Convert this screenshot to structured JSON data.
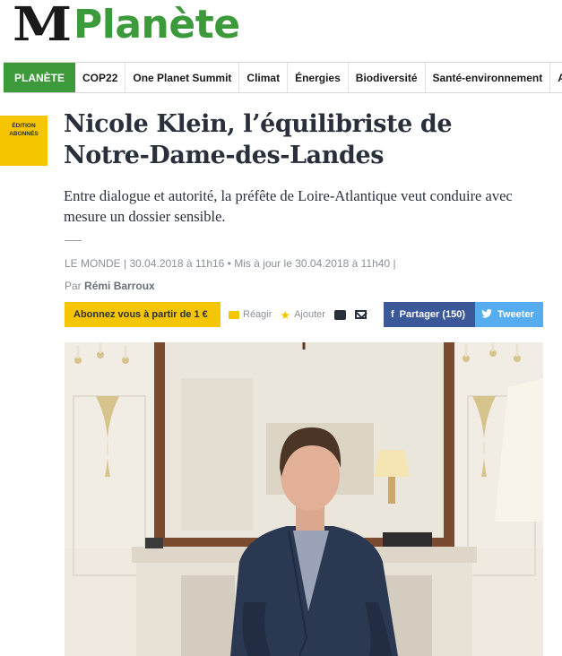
{
  "masthead": {
    "logo": "M",
    "section": "Planète"
  },
  "nav": {
    "home": "PLANÈTE",
    "items": [
      "COP22",
      "One Planet Summit",
      "Climat",
      "Énergies",
      "Biodiversité",
      "Santé-environnement",
      "Ag"
    ]
  },
  "badge": {
    "line1": "ÉDITION",
    "line2": "ABONNÉS"
  },
  "article": {
    "title": "Nicole Klein, l’équilibriste de Notre-Dame-des-Landes",
    "deck": "Entre dialogue et autorité, la préfête de Loire-Atlantique veut conduire avec mesure un dossier sensible.",
    "meta": "LE MONDE | 30.04.2018 à 11h16 • Mis à jour le 30.04.2018 à 11h40 |",
    "byline_prefix": "Par",
    "author": "Rémi Barroux"
  },
  "share": {
    "subscribe": "Abonnez vous à partir de 1 €",
    "react": "Réagir",
    "add": "Ajouter",
    "facebook_icon": "f",
    "facebook": "Partager (150)",
    "twitter": "Tweeter"
  },
  "colors": {
    "brand_green": "#3c9a3a",
    "subscriber_yellow": "#f5c500",
    "facebook": "#3b5998",
    "twitter": "#55acee"
  }
}
